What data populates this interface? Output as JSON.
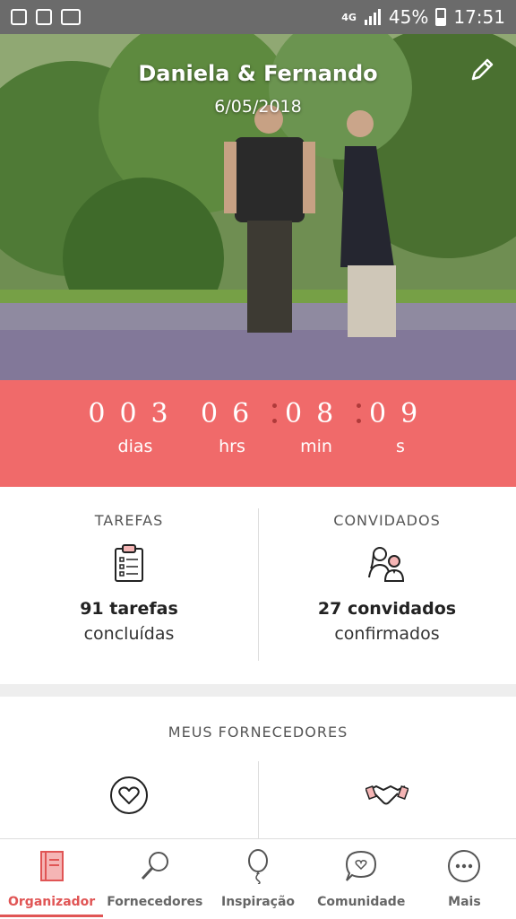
{
  "status_bar": {
    "network": "4G",
    "battery": "45%",
    "time": "17:51"
  },
  "hero": {
    "couple_names": "Daniela & Fernando",
    "date": "6/05/2018"
  },
  "countdown": {
    "days": "003",
    "hours": "06",
    "minutes": "08",
    "seconds": "09",
    "days_label": "dias",
    "hours_label": "hrs",
    "minutes_label": "min",
    "seconds_label": "s"
  },
  "tasks": {
    "title": "TAREFAS",
    "value": "91 tarefas",
    "subtitle": "concluídas"
  },
  "guests": {
    "title": "CONVIDADOS",
    "value": "27 convidados",
    "subtitle": "confirmados"
  },
  "vendors": {
    "title": "MEUS FORNECEDORES"
  },
  "nav": {
    "items": [
      {
        "label": "Organizador",
        "icon": "notebook-icon"
      },
      {
        "label": "Fornecedores",
        "icon": "magnifier-icon"
      },
      {
        "label": "Inspiração",
        "icon": "balloon-icon"
      },
      {
        "label": "Comunidade",
        "icon": "chat-heart-icon"
      },
      {
        "label": "Mais",
        "icon": "more-dots-icon"
      }
    ]
  },
  "colors": {
    "accent": "#f06a6a",
    "active_nav": "#e05555"
  }
}
